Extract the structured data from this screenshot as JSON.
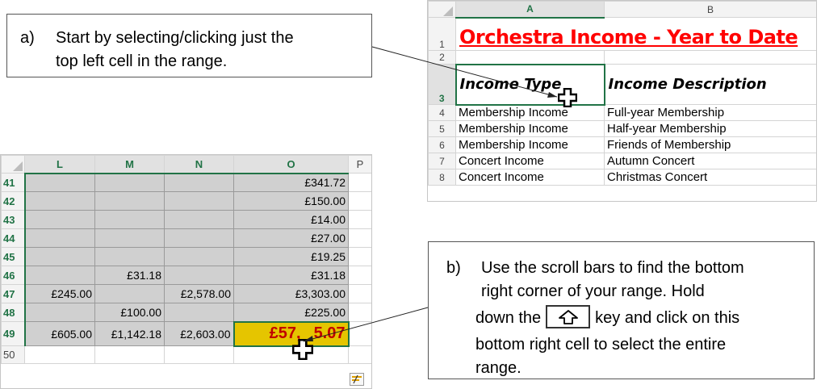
{
  "callout_a": {
    "marker": "a)",
    "line1": "Start by selecting/clicking just the",
    "line2": "top left cell in the range."
  },
  "callout_b": {
    "marker": "b)",
    "line1": "Use the scroll bars to find the bottom",
    "line2": "right corner of your range.  Hold",
    "line3_before": "down the",
    "line3_after": "key and click on this",
    "line4": "bottom right cell to select the entire",
    "line5": "range.",
    "key_icon": "shift-arrow-icon"
  },
  "sheet_top": {
    "col_headers": [
      "A",
      "B"
    ],
    "rows": [
      {
        "num": "1",
        "a": "Orchestra Income - Year to Date",
        "b": ""
      },
      {
        "num": "2",
        "a": "",
        "b": ""
      },
      {
        "num": "3",
        "a": "Income Type",
        "b": "Income Description"
      },
      {
        "num": "4",
        "a": "Membership Income",
        "b": "Full-year Membership"
      },
      {
        "num": "5",
        "a": "Membership Income",
        "b": "Half-year Membership"
      },
      {
        "num": "6",
        "a": "Membership Income",
        "b": "Friends of Membership"
      },
      {
        "num": "7",
        "a": "Concert Income",
        "b": "Autumn Concert"
      },
      {
        "num": "8",
        "a": "Concert Income",
        "b": "Christmas Concert"
      }
    ],
    "title_color": "#ff0000"
  },
  "sheet_bottom": {
    "col_headers": [
      "L",
      "M",
      "N",
      "O",
      "P"
    ],
    "rows": [
      {
        "num": "41",
        "l": "",
        "m": "",
        "n": "",
        "o": "£341.72"
      },
      {
        "num": "42",
        "l": "",
        "m": "",
        "n": "",
        "o": "£150.00"
      },
      {
        "num": "43",
        "l": "",
        "m": "",
        "n": "",
        "o": "£14.00"
      },
      {
        "num": "44",
        "l": "",
        "m": "",
        "n": "",
        "o": "£27.00"
      },
      {
        "num": "45",
        "l": "",
        "m": "",
        "n": "",
        "o": "£19.25"
      },
      {
        "num": "46",
        "l": "",
        "m": "£31.18",
        "n": "",
        "o": "£31.18"
      },
      {
        "num": "47",
        "l": "£245.00",
        "m": "",
        "n": "£2,578.00",
        "o": "£3,303.00"
      },
      {
        "num": "48",
        "l": "",
        "m": "£100.00",
        "n": "",
        "o": "£225.00"
      },
      {
        "num": "49",
        "l": "£605.00",
        "m": "£1,142.18",
        "n": "£2,603.00",
        "o": "£57,",
        "o_after": "5.07"
      },
      {
        "num": "50",
        "l": "",
        "m": "",
        "n": "",
        "o": ""
      }
    ],
    "total_bg": "#e5c500",
    "total_color": "#c00000",
    "accent": "#217346"
  }
}
